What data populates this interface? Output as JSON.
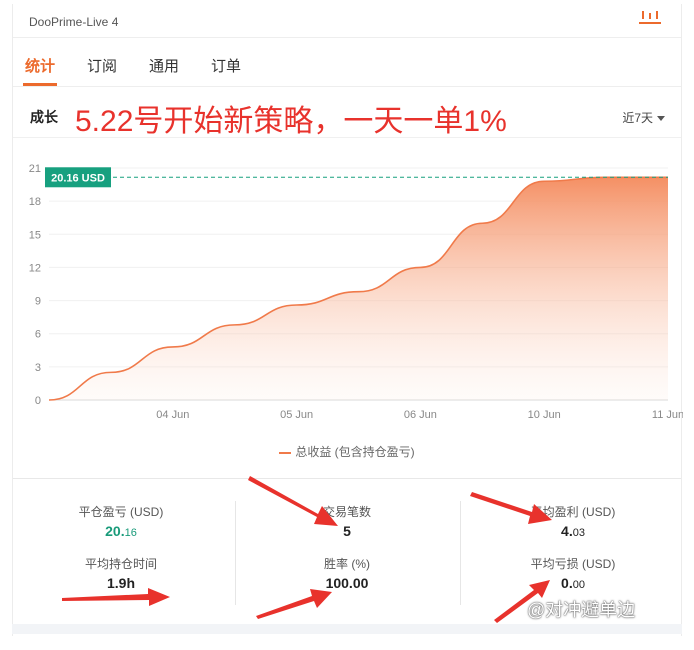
{
  "window": {
    "title": "DooPrime-Live 4",
    "top_icon": "bar-menu-icon"
  },
  "tabs": [
    {
      "label": "统计",
      "active": true
    },
    {
      "label": "订阅",
      "active": false
    },
    {
      "label": "通用",
      "active": false
    },
    {
      "label": "订单",
      "active": false
    }
  ],
  "section": {
    "title": "成长",
    "annotation": "5.22号开始新策略，一天一单1%",
    "range": "近7天"
  },
  "colors": {
    "accent": "#ec6a2c",
    "line": "#f07a4a",
    "badge": "#17a07f",
    "annotation": "#e8322c",
    "arrows": "#e8322c"
  },
  "chart_data": {
    "type": "area",
    "x_ticks": [
      "04 Jun",
      "05 Jun",
      "06 Jun",
      "10 Jun",
      "11 Jun"
    ],
    "y_ticks": [
      0,
      3,
      6,
      9,
      12,
      15,
      18,
      21
    ],
    "ylim": [
      0,
      21
    ],
    "series": [
      {
        "name": "总收益 (包含持仓盈亏)",
        "x": [
          0,
          0.5,
          1,
          1.5,
          2,
          2.5,
          3,
          3.5,
          4,
          4.5,
          5
        ],
        "values": [
          0,
          2.5,
          4.8,
          6.8,
          8.6,
          9.8,
          12.0,
          16.0,
          19.8,
          20.16,
          20.16
        ]
      }
    ],
    "x_positions": {
      "04 Jun": 1,
      "05 Jun": 2,
      "06 Jun": 3,
      "10 Jun": 4,
      "11 Jun": 5
    },
    "marker_label": "20.16 USD",
    "marker_value": 20.16,
    "legend": "总收益 (包含持仓盈亏)",
    "grid": true
  },
  "stats": {
    "closed_pnl_label": "平仓盈亏 (USD)",
    "closed_pnl_int": "20.",
    "closed_pnl_dec": "16",
    "trades_label": "交易笔数",
    "trades_value": "5",
    "avg_profit_label": "平均盈利 (USD)",
    "avg_profit_int": "4.",
    "avg_profit_dec": "03",
    "hold_time_label": "平均持仓时间",
    "hold_time_value": "1.9h",
    "win_rate_label": "胜率 (%)",
    "win_rate_value": "100.00",
    "avg_loss_label": "平均亏损 (USD)",
    "avg_loss_int": "0.",
    "avg_loss_dec": "00"
  },
  "watermark": "@对冲避单边"
}
